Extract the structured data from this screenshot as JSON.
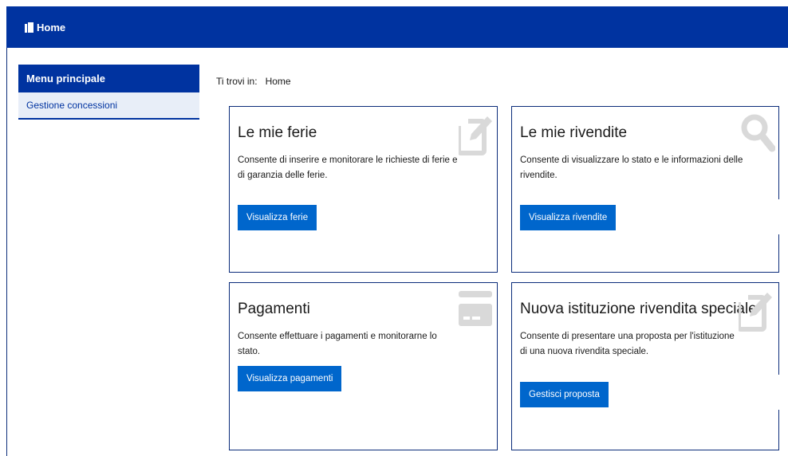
{
  "header": {
    "title": "Home",
    "icon": "document-icon"
  },
  "sidebar": {
    "title": "Menu principale",
    "items": [
      {
        "label": "Gestione concessioni"
      }
    ]
  },
  "breadcrumb": {
    "prefix": "Ti trovi in:",
    "current": "Home"
  },
  "cards": [
    {
      "title": "Le mie ferie",
      "description": "Consente di inserire e monitorare le richieste di ferie e di garanzia delle ferie.",
      "button": "Visualizza ferie",
      "icon": "edit-icon"
    },
    {
      "title": "Le mie rivendite",
      "description": "Consente di visualizzare lo stato e le informazioni delle rivendite.",
      "button": "Visualizza rivendite",
      "icon": "search-icon"
    },
    {
      "title": "Pagamenti",
      "description": "Consente effettuare i pagamenti e monitorarne lo stato.",
      "button": "Visualizza pagamenti",
      "icon": "credit-card-icon"
    },
    {
      "title": "Nuova istituzione rivendita speciale",
      "description": "Consente di presentare una proposta per l'istituzione di una nuova rivendita speciale.",
      "button": "Gestisci proposta",
      "icon": "edit-icon"
    }
  ],
  "colors": {
    "primary": "#0033a0",
    "button": "#0066cc",
    "icon": "#d9d9d9"
  }
}
